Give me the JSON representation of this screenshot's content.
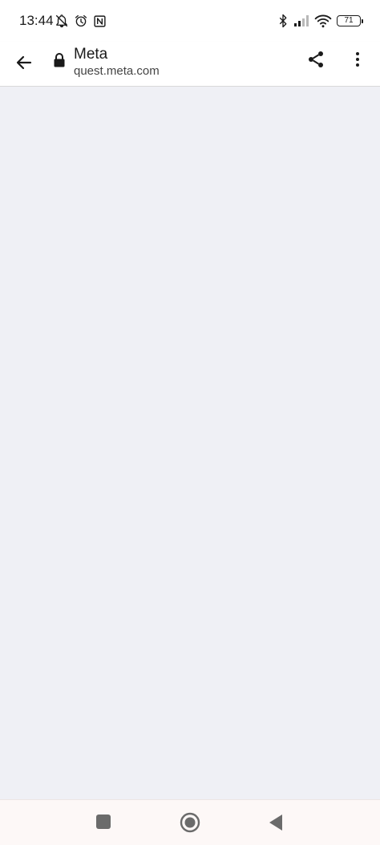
{
  "status_bar": {
    "time": "13:44",
    "left_icons": [
      "bell-off-icon",
      "alarm-icon",
      "nfc-icon"
    ],
    "right_icons": [
      "bluetooth-icon",
      "cell-signal-icon",
      "wifi-icon"
    ],
    "battery_level": "71"
  },
  "toolbar": {
    "title": "Meta",
    "url": "quest.meta.com",
    "icons": [
      "back-arrow-icon",
      "lock-icon",
      "share-icon",
      "more-vert-icon"
    ]
  },
  "content": {
    "background_color": "#eff0f5"
  },
  "nav_bar": {
    "icons": [
      "recents-square-icon",
      "home-circle-icon",
      "back-triangle-icon"
    ]
  },
  "colors": {
    "toolbar_background": "#ffffff",
    "content_background": "#eff0f5",
    "nav_background": "#fdf8f7",
    "icon_color": "#1a1a1a",
    "nav_icon_color": "#6b6b6b"
  }
}
